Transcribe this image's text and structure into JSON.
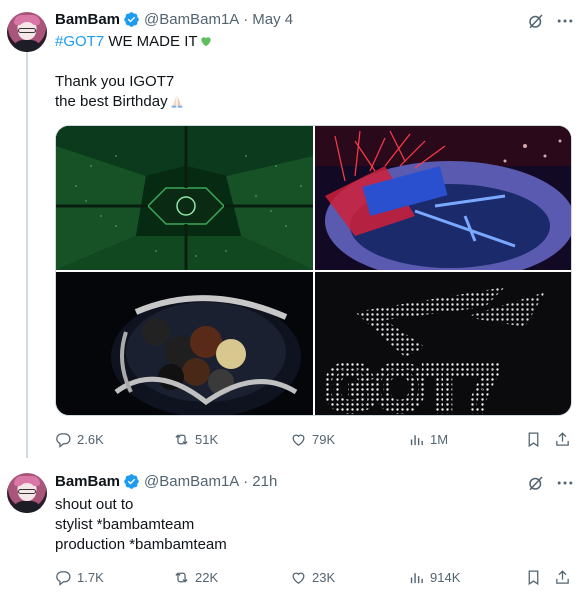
{
  "tweets": [
    {
      "author": "BamBam",
      "handle": "@BamBam1A",
      "separator": "·",
      "time": "May 4",
      "text_hashtag": "#GOT7",
      "text_line1_rest": " WE MADE IT",
      "text_line2": "Thank you IGOT7",
      "text_line3": "the best Birthday",
      "media_text": "GOT7",
      "replies": "2.6K",
      "reposts": "51K",
      "likes": "79K",
      "views": "1M"
    },
    {
      "author": "BamBam",
      "handle": "@BamBam1A",
      "separator": "·",
      "time": "21h",
      "text_line1": "shout out to",
      "text_line2": "stylist *bambamteam",
      "text_line3": "production *bambamteam",
      "replies": "1.7K",
      "reposts": "22K",
      "likes": "23K",
      "views": "914K"
    }
  ],
  "colors": {
    "accent": "#1d9bf0",
    "muted": "#536471",
    "text": "#0f1419",
    "heart_emoji": "#5fbf5f"
  },
  "icons": [
    "verified-badge-icon",
    "grok-icon",
    "more-icon",
    "reply-icon",
    "repost-icon",
    "like-icon",
    "views-icon",
    "bookmark-icon",
    "share-icon",
    "green-heart-emoji",
    "folded-hands-emoji"
  ]
}
